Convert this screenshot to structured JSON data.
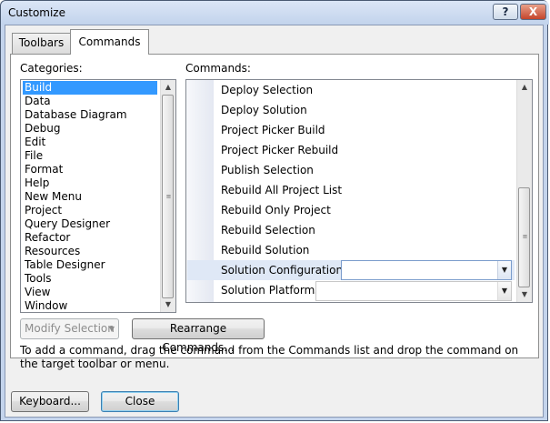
{
  "window": {
    "title": "Customize",
    "help_glyph": "?",
    "close_glyph": "X"
  },
  "tabs": [
    {
      "label": "Toolbars",
      "selected": false
    },
    {
      "label": "Commands",
      "selected": true
    }
  ],
  "categories": {
    "label": "Categories:",
    "items": [
      "Build",
      "Data",
      "Database Diagram",
      "Debug",
      "Edit",
      "File",
      "Format",
      "Help",
      "New Menu",
      "Project",
      "Query Designer",
      "Refactor",
      "Resources",
      "Table Designer",
      "Tools",
      "View",
      "Window"
    ],
    "selected": "Build"
  },
  "commands": {
    "label": "Commands:",
    "items": [
      "Deploy Selection",
      "Deploy Solution",
      "Project Picker Build",
      "Project Picker Rebuild",
      "Publish Selection",
      "Rebuild All Project List",
      "Rebuild Only Project",
      "Rebuild Selection",
      "Rebuild Solution",
      "Solution Configurations",
      "Solution Platforms"
    ],
    "highlighted": "Solution Configurations"
  },
  "buttons": {
    "modify_selection": "Modify Selection",
    "rearrange_commands": "Rearrange Commands...",
    "keyboard": "Keyboard...",
    "close": "Close"
  },
  "help_text": "To add a command, drag the command from the Commands list and drop the command on the target toolbar or menu.",
  "icons": {
    "scroll_up": "▲",
    "scroll_down": "▼",
    "dropdown": "▼",
    "grip": "≡"
  },
  "colors": {
    "selection": "#3399ff",
    "title_bar": "#c2d3ec",
    "close_button": "#c4452b",
    "dialog_background": "#f0f0f0"
  }
}
